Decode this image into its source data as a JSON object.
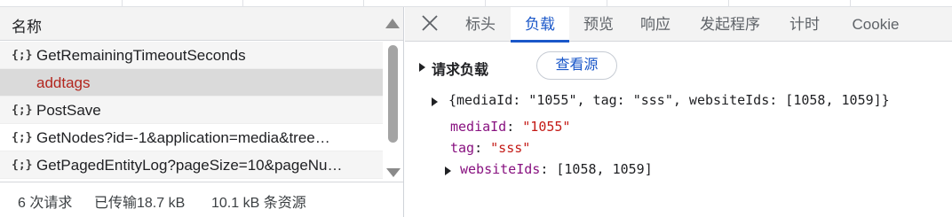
{
  "network_list": {
    "header": "名称",
    "rows": [
      {
        "icon": "{;}",
        "name": "GetRemainingTimeoutSeconds",
        "selected": false
      },
      {
        "icon": "",
        "name": "addtags",
        "selected": true
      },
      {
        "icon": "{;}",
        "name": "PostSave",
        "selected": false
      },
      {
        "icon": "{;}",
        "name": "GetNodes?id=-1&application=media&tree…",
        "selected": false
      },
      {
        "icon": "{;}",
        "name": "GetPagedEntityLog?pageSize=10&pageNu…",
        "selected": false
      }
    ]
  },
  "status_bar": {
    "requests": "6 次请求",
    "transferred": "已传输18.7 kB",
    "resources": "10.1 kB 条资源"
  },
  "tabs": [
    {
      "label": "标头",
      "active": false
    },
    {
      "label": "负载",
      "active": true
    },
    {
      "label": "预览",
      "active": false
    },
    {
      "label": "响应",
      "active": false
    },
    {
      "label": "发起程序",
      "active": false
    },
    {
      "label": "计时",
      "active": false
    },
    {
      "label": "Cookie",
      "active": false
    }
  ],
  "payload": {
    "section_title": "请求负载",
    "view_source_label": "查看源",
    "summary": "{mediaId: \"1055\", tag: \"sss\", websiteIds: [1058, 1059]}",
    "properties": [
      {
        "key": "mediaId",
        "value": "\"1055\""
      },
      {
        "key": "tag",
        "value": "\"sss\""
      },
      {
        "key": "websiteIds",
        "value": "[1058, 1059]"
      }
    ]
  },
  "colors": {
    "accent": "#1a57c9",
    "selected_row_text": "#b3261e",
    "json_key": "#881280",
    "json_string": "#c41a16"
  },
  "icons": {
    "close": "close-icon",
    "sort": "sort-ascending-icon",
    "expand": "disclosure-triangle-icon"
  }
}
